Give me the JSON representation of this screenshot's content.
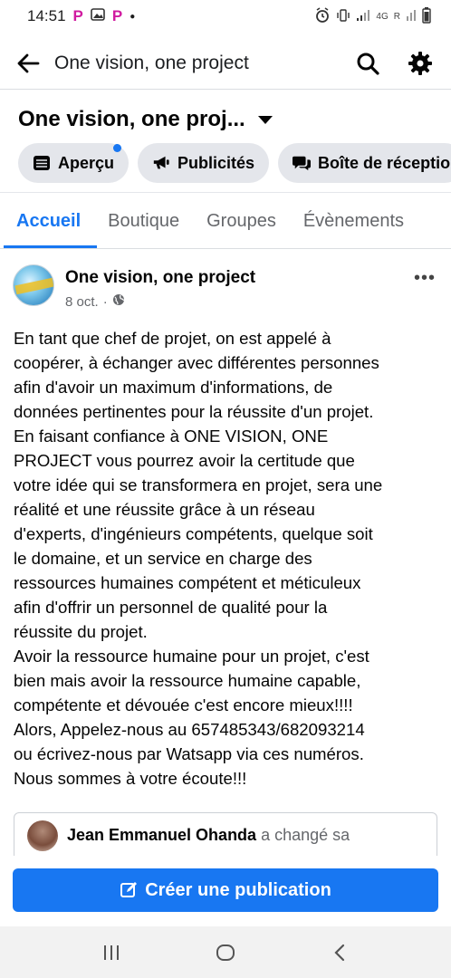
{
  "status_bar": {
    "time": "14:51",
    "network": "4G",
    "roaming": "R"
  },
  "header": {
    "title": "One vision, one project",
    "icons": [
      "back-arrow-icon",
      "search-icon",
      "gear-icon"
    ]
  },
  "page": {
    "name": "One vision, one proj..."
  },
  "chips": [
    {
      "label": "Aperçu",
      "icon": "table-icon",
      "has_notification": true
    },
    {
      "label": "Publicités",
      "icon": "megaphone-icon"
    },
    {
      "label": "Boîte de réceptio",
      "icon": "chat-bubbles-icon"
    }
  ],
  "tabs": [
    {
      "label": "Accueil",
      "active": true
    },
    {
      "label": "Boutique"
    },
    {
      "label": "Groupes"
    },
    {
      "label": "Évènements"
    }
  ],
  "post": {
    "author": "One vision, one project",
    "date": "8 oct.",
    "separator": "·",
    "body": "En tant que chef de projet, on est appelé à\ncoopérer, à échanger avec différentes personnes\nafin d'avoir un maximum d'informations, de\ndonnées pertinentes pour la réussite d'un projet.\nEn faisant confiance à ONE VISION, ONE\nPROJECT  vous pourrez avoir la certitude que\nvotre idée qui se transformera en projet, sera une\nréalité et une réussite grâce à un réseau\nd'experts, d'ingénieurs compétents, quelque soit\nle domaine, et un service en charge des\nressources humaines compétent et méticuleux\nafin d'offrir un personnel de qualité pour la\nréussite du projet.\nAvoir la ressource humaine pour un projet, c'est\nbien mais avoir la ressource humaine capable,\ncompétente et dévouée  c'est encore mieux!!!!\nAlors, Appelez-nous au 657485343/682093214\nou écrivez-nous par Watsapp via ces numéros.\nNous sommes à votre écoute!!!"
  },
  "shared": {
    "name": "Jean Emmanuel Ohanda",
    "action": "a changé sa"
  },
  "create_button": {
    "label": "Créer une publication"
  },
  "colors": {
    "accent": "#1877f2",
    "chip_bg": "#e4e6eb",
    "muted_text": "#65676b"
  }
}
